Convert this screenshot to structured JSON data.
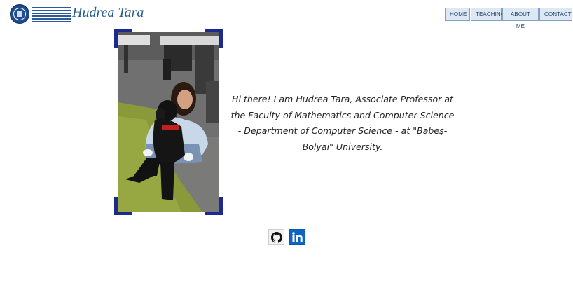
{
  "header": {
    "logo": {
      "name": "university-logo-icon",
      "text": [
        "UNIVERSITATEA BABEȘ-BOLYAI",
        "BABEȘ-BOLYAI TUDOMÁNYEGYETEM",
        "BABEȘ-BOLYAI UNIVERSITÄT",
        "BABEȘ-BOLYAI UNIVERSITY"
      ]
    },
    "site_title": "Hudrea Tara",
    "nav": [
      {
        "label": "HOME"
      },
      {
        "label": "TEACHING"
      },
      {
        "label": "ABOUT ME"
      },
      {
        "label": "CONTACT"
      }
    ]
  },
  "profile": {
    "bio": "Hi there! I am Hudrea Tara, Associate Professor at the Faculty of Mathematics and Computer Science - Department of Computer Science - at \"Babeș-Bolyai\" University."
  },
  "social": [
    {
      "icon": "github-icon"
    },
    {
      "icon": "linkedin-icon"
    }
  ],
  "colors": {
    "frame_corners": "#1b2a8c",
    "nav_background": "#dce9f5",
    "title": "#245c8e",
    "linkedin": "#0b66c2"
  }
}
